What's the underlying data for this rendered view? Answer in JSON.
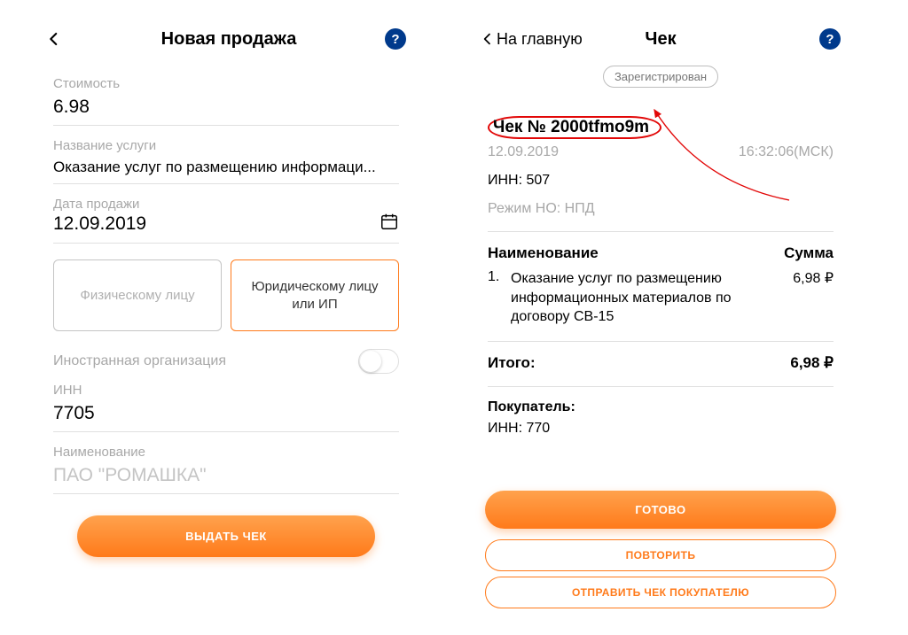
{
  "left": {
    "title": "Новая продажа",
    "help": "?",
    "cost_label": "Стоимость",
    "cost_value": "6.98",
    "service_label": "Название услуги",
    "service_value": "Оказание услуг по размещению информаци...",
    "date_label": "Дата продажи",
    "date_value": "12.09.2019",
    "choice_individual": "Физическому лицу",
    "choice_legal": "Юридическому лицу или ИП",
    "foreign_label": "Иностранная организация",
    "inn_label": "ИНН",
    "inn_value": "7705",
    "name_label": "Наименование",
    "name_placeholder": "ПАО \"РОМАШКА\"",
    "submit": "Выдать чек"
  },
  "right": {
    "back_label": "На главную",
    "title": "Чек",
    "help": "?",
    "status_badge": "Зарегистрирован",
    "check_number": "Чек № 2000tfmo9m",
    "date": "12.09.2019",
    "time": "16:32:06(МСК)",
    "inn_line": "ИНН: 507",
    "regime_line": "Режим НО: НПД",
    "col_name": "Наименование",
    "col_sum": "Сумма",
    "item_idx": "1.",
    "item_name": "Оказание услуг по размещению информационных материалов по договору СВ-15",
    "item_amount": "6,98 ₽",
    "total_label": "Итого:",
    "total_amount": "6,98 ₽",
    "buyer_label": "Покупатель:",
    "buyer_inn": "ИНН: 770",
    "btn_done": "Готово",
    "btn_repeat": "Повторить",
    "btn_send": "Отправить чек покупателю"
  }
}
